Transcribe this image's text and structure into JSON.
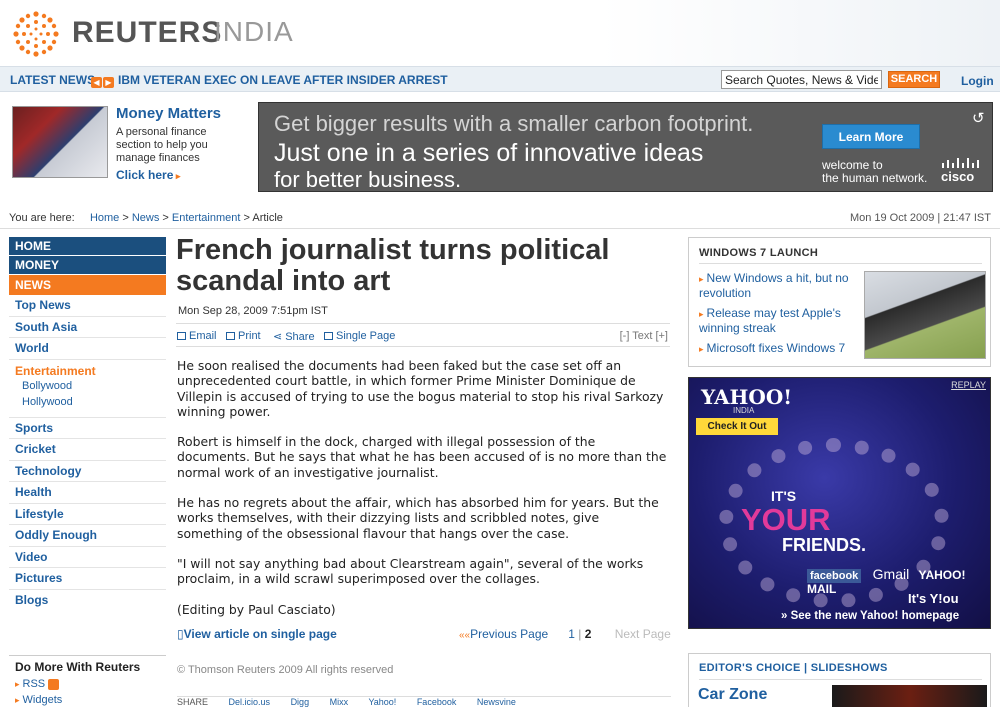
{
  "brand": {
    "name": "REUTERS",
    "edition": "INDIA"
  },
  "newsbar": {
    "label": "LATEST NEWS",
    "headline": "IBM VETERAN EXEC ON LEAVE AFTER INSIDER ARREST",
    "search_placeholder": "Search Quotes, News & Video",
    "search_button": "SEARCH",
    "login": "Login"
  },
  "promo": {
    "title": "Money Matters",
    "text": "A personal finance section to help you manage finances",
    "link": "Click here"
  },
  "banner": {
    "line1": "Get bigger results with a smaller carbon footprint.",
    "line2": "Just one in a series of innovative ideas",
    "line3": "for better business.",
    "button": "Learn More",
    "welcome": "welcome to",
    "welcome2": "the human network.",
    "brand": "cisco"
  },
  "breadcrumb": {
    "label": "You are here:",
    "home": "Home",
    "news": "News",
    "entertainment": "Entertainment",
    "article": "Article",
    "sep": ">"
  },
  "top_date": "Mon 19 Oct 2009 | 21:47 IST",
  "nav": {
    "home": "HOME",
    "money": "MONEY",
    "news": "NEWS",
    "top_news": "Top News",
    "south_asia": "South Asia",
    "world": "World",
    "entertainment": "Entertainment",
    "bollywood": "Bollywood",
    "hollywood": "Hollywood",
    "sports": "Sports",
    "cricket": "Cricket",
    "technology": "Technology",
    "health": "Health",
    "lifestyle": "Lifestyle",
    "oddly": "Oddly Enough",
    "video": "Video",
    "pictures": "Pictures",
    "blogs": "Blogs"
  },
  "domore": {
    "heading": "Do More With Reuters",
    "rss": "RSS",
    "widgets": "Widgets"
  },
  "article": {
    "headline": "French journalist turns political scandal into art",
    "dateline": "Mon Sep 28, 2009 7:51pm IST",
    "tools": {
      "email": "Email",
      "print": "Print",
      "share": "Share",
      "single": "Single Page",
      "textsize": "[-] Text [+]"
    },
    "paragraphs": [
      "He soon realised the documents had been faked but the case set off an unprecedented court battle, in which former Prime Minister Dominique de Villepin is accused of trying to use the bogus material to stop his rival Sarkozy winning power.",
      "Robert is himself in the dock, charged with illegal possession of the documents. But he says that what he has been accused of is no more than the normal work of an investigative journalist.",
      "He has no regrets about the affair, which has absorbed him for years. But the works themselves, with their dizzying lists and scribbled notes, give something of the obsessional flavour that hangs over the case.",
      "\"I will not say anything bad about Clearstream again\", several of the works proclaim, in a wild scrawl superimposed over the collages.",
      "(Editing by Paul Casciato)"
    ],
    "single_view": "View article on single page",
    "pager": {
      "prev": "Previous Page",
      "p1": "1",
      "sep": "|",
      "p2": "2",
      "next": "Next Page"
    },
    "copyright": "© Thomson Reuters 2009 All rights reserved",
    "share_row": [
      "SHARE",
      "Del.icio.us",
      "Digg",
      "Mixx",
      "Yahoo!",
      "Facebook",
      "Newsvine"
    ]
  },
  "windows7": {
    "heading": "WINDOWS 7 LAUNCH",
    "items": [
      "New Windows a hit, but no revolution",
      "Release may test Apple's winning streak",
      "Microsoft fixes Windows 7"
    ]
  },
  "yahoo_ad": {
    "logo": "YAHOO!",
    "india": "INDIA",
    "replay": "REPLAY",
    "check": "Check It Out",
    "its": "IT'S",
    "your": "YOUR",
    "friends": "FRIENDS.",
    "facebook": "facebook",
    "gmail": "Gmail",
    "yahoomail": "YAHOO! MAIL",
    "itsyou": "It's Y!ou",
    "see": "» See the new Yahoo! homepage"
  },
  "editors": {
    "heading": "EDITOR'S CHOICE | SLIDESHOWS",
    "title": "Car Zone"
  },
  "colors": {
    "accent": "#f47a20",
    "navy": "#1b4f7e",
    "link": "#1f5f9f"
  }
}
